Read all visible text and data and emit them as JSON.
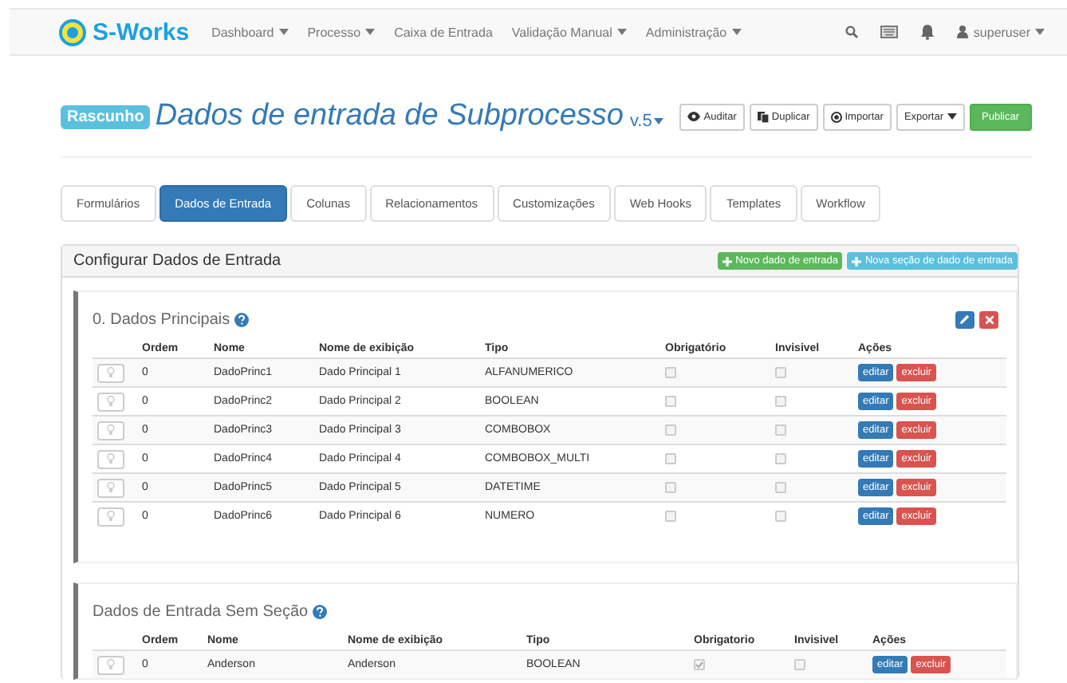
{
  "navbar": {
    "brand": "S-Works",
    "menu": [
      {
        "label": "Dashboard",
        "dropdown": true
      },
      {
        "label": "Processo",
        "dropdown": true
      },
      {
        "label": "Caixa de Entrada",
        "dropdown": false
      },
      {
        "label": "Validação Manual",
        "dropdown": true
      },
      {
        "label": "Administração",
        "dropdown": true
      }
    ],
    "user": "superuser"
  },
  "header": {
    "badge": "Rascunho",
    "title": "Dados de entrada de Subprocesso",
    "version": "v.5",
    "buttons": [
      {
        "label": "Auditar",
        "kind": "eye"
      },
      {
        "label": "Duplicar",
        "kind": "copy"
      },
      {
        "label": "Importar",
        "kind": "import"
      },
      {
        "label": "Exportar",
        "kind": "dropdown"
      },
      {
        "label": "Publicar",
        "kind": "primary"
      }
    ]
  },
  "tabs": [
    {
      "label": "Formulários",
      "selected": false
    },
    {
      "label": "Dados de Entrada",
      "selected": true
    },
    {
      "label": "Colunas",
      "selected": false
    },
    {
      "label": "Relacionamentos",
      "selected": false
    },
    {
      "label": "Customizações",
      "selected": false
    },
    {
      "label": "Web Hooks",
      "selected": false
    },
    {
      "label": "Templates",
      "selected": false
    },
    {
      "label": "Workflow",
      "selected": false
    }
  ],
  "panel": {
    "title": "Configurar Dados de Entrada",
    "actions": [
      {
        "label": "Novo dado de entrada",
        "kind": "success"
      },
      {
        "label": "Nova seção de dado de entrada",
        "kind": "info"
      }
    ]
  },
  "sections": [
    {
      "title": "0. Dados Principais",
      "controls": true,
      "columns": [
        "Ordem",
        "Nome",
        "Nome de exibição",
        "Tipo",
        "Obrigatório",
        "Invisivel",
        "Ações"
      ],
      "rows": [
        {
          "ordem": "0",
          "nome": "DadoPrinc1",
          "exibicao": "Dado Principal 1",
          "tipo": "ALFANUMERICO",
          "obrigatorio": false,
          "invisivel": false,
          "edit": "editar",
          "delete": "excluir"
        },
        {
          "ordem": "0",
          "nome": "DadoPrinc2",
          "exibicao": "Dado Principal 2",
          "tipo": "BOOLEAN",
          "obrigatorio": false,
          "invisivel": false,
          "edit": "editar",
          "delete": "excluir"
        },
        {
          "ordem": "0",
          "nome": "DadoPrinc3",
          "exibicao": "Dado Principal 3",
          "tipo": "COMBOBOX",
          "obrigatorio": false,
          "invisivel": false,
          "edit": "editar",
          "delete": "excluir"
        },
        {
          "ordem": "0",
          "nome": "DadoPrinc4",
          "exibicao": "Dado Principal 4",
          "tipo": "COMBOBOX_MULTI",
          "obrigatorio": false,
          "invisivel": false,
          "edit": "editar",
          "delete": "excluir"
        },
        {
          "ordem": "0",
          "nome": "DadoPrinc5",
          "exibicao": "Dado Principal 5",
          "tipo": "DATETIME",
          "obrigatorio": false,
          "invisivel": false,
          "edit": "editar",
          "delete": "excluir"
        },
        {
          "ordem": "0",
          "nome": "DadoPrinc6",
          "exibicao": "Dado Principal 6",
          "tipo": "NUMERO",
          "obrigatorio": false,
          "invisivel": false,
          "edit": "editar",
          "delete": "excluir"
        }
      ]
    },
    {
      "title": "Dados de Entrada Sem Seção",
      "controls": false,
      "columns": [
        "Ordem",
        "Nome",
        "Nome de exibição",
        "Tipo",
        "Obrigatorio",
        "Invisivel",
        "Ações"
      ],
      "rows": [
        {
          "ordem": "0",
          "nome": "Anderson",
          "exibicao": "Anderson",
          "tipo": "BOOLEAN",
          "obrigatorio": true,
          "invisivel": false,
          "edit": "editar",
          "delete": "excluir"
        }
      ]
    }
  ]
}
